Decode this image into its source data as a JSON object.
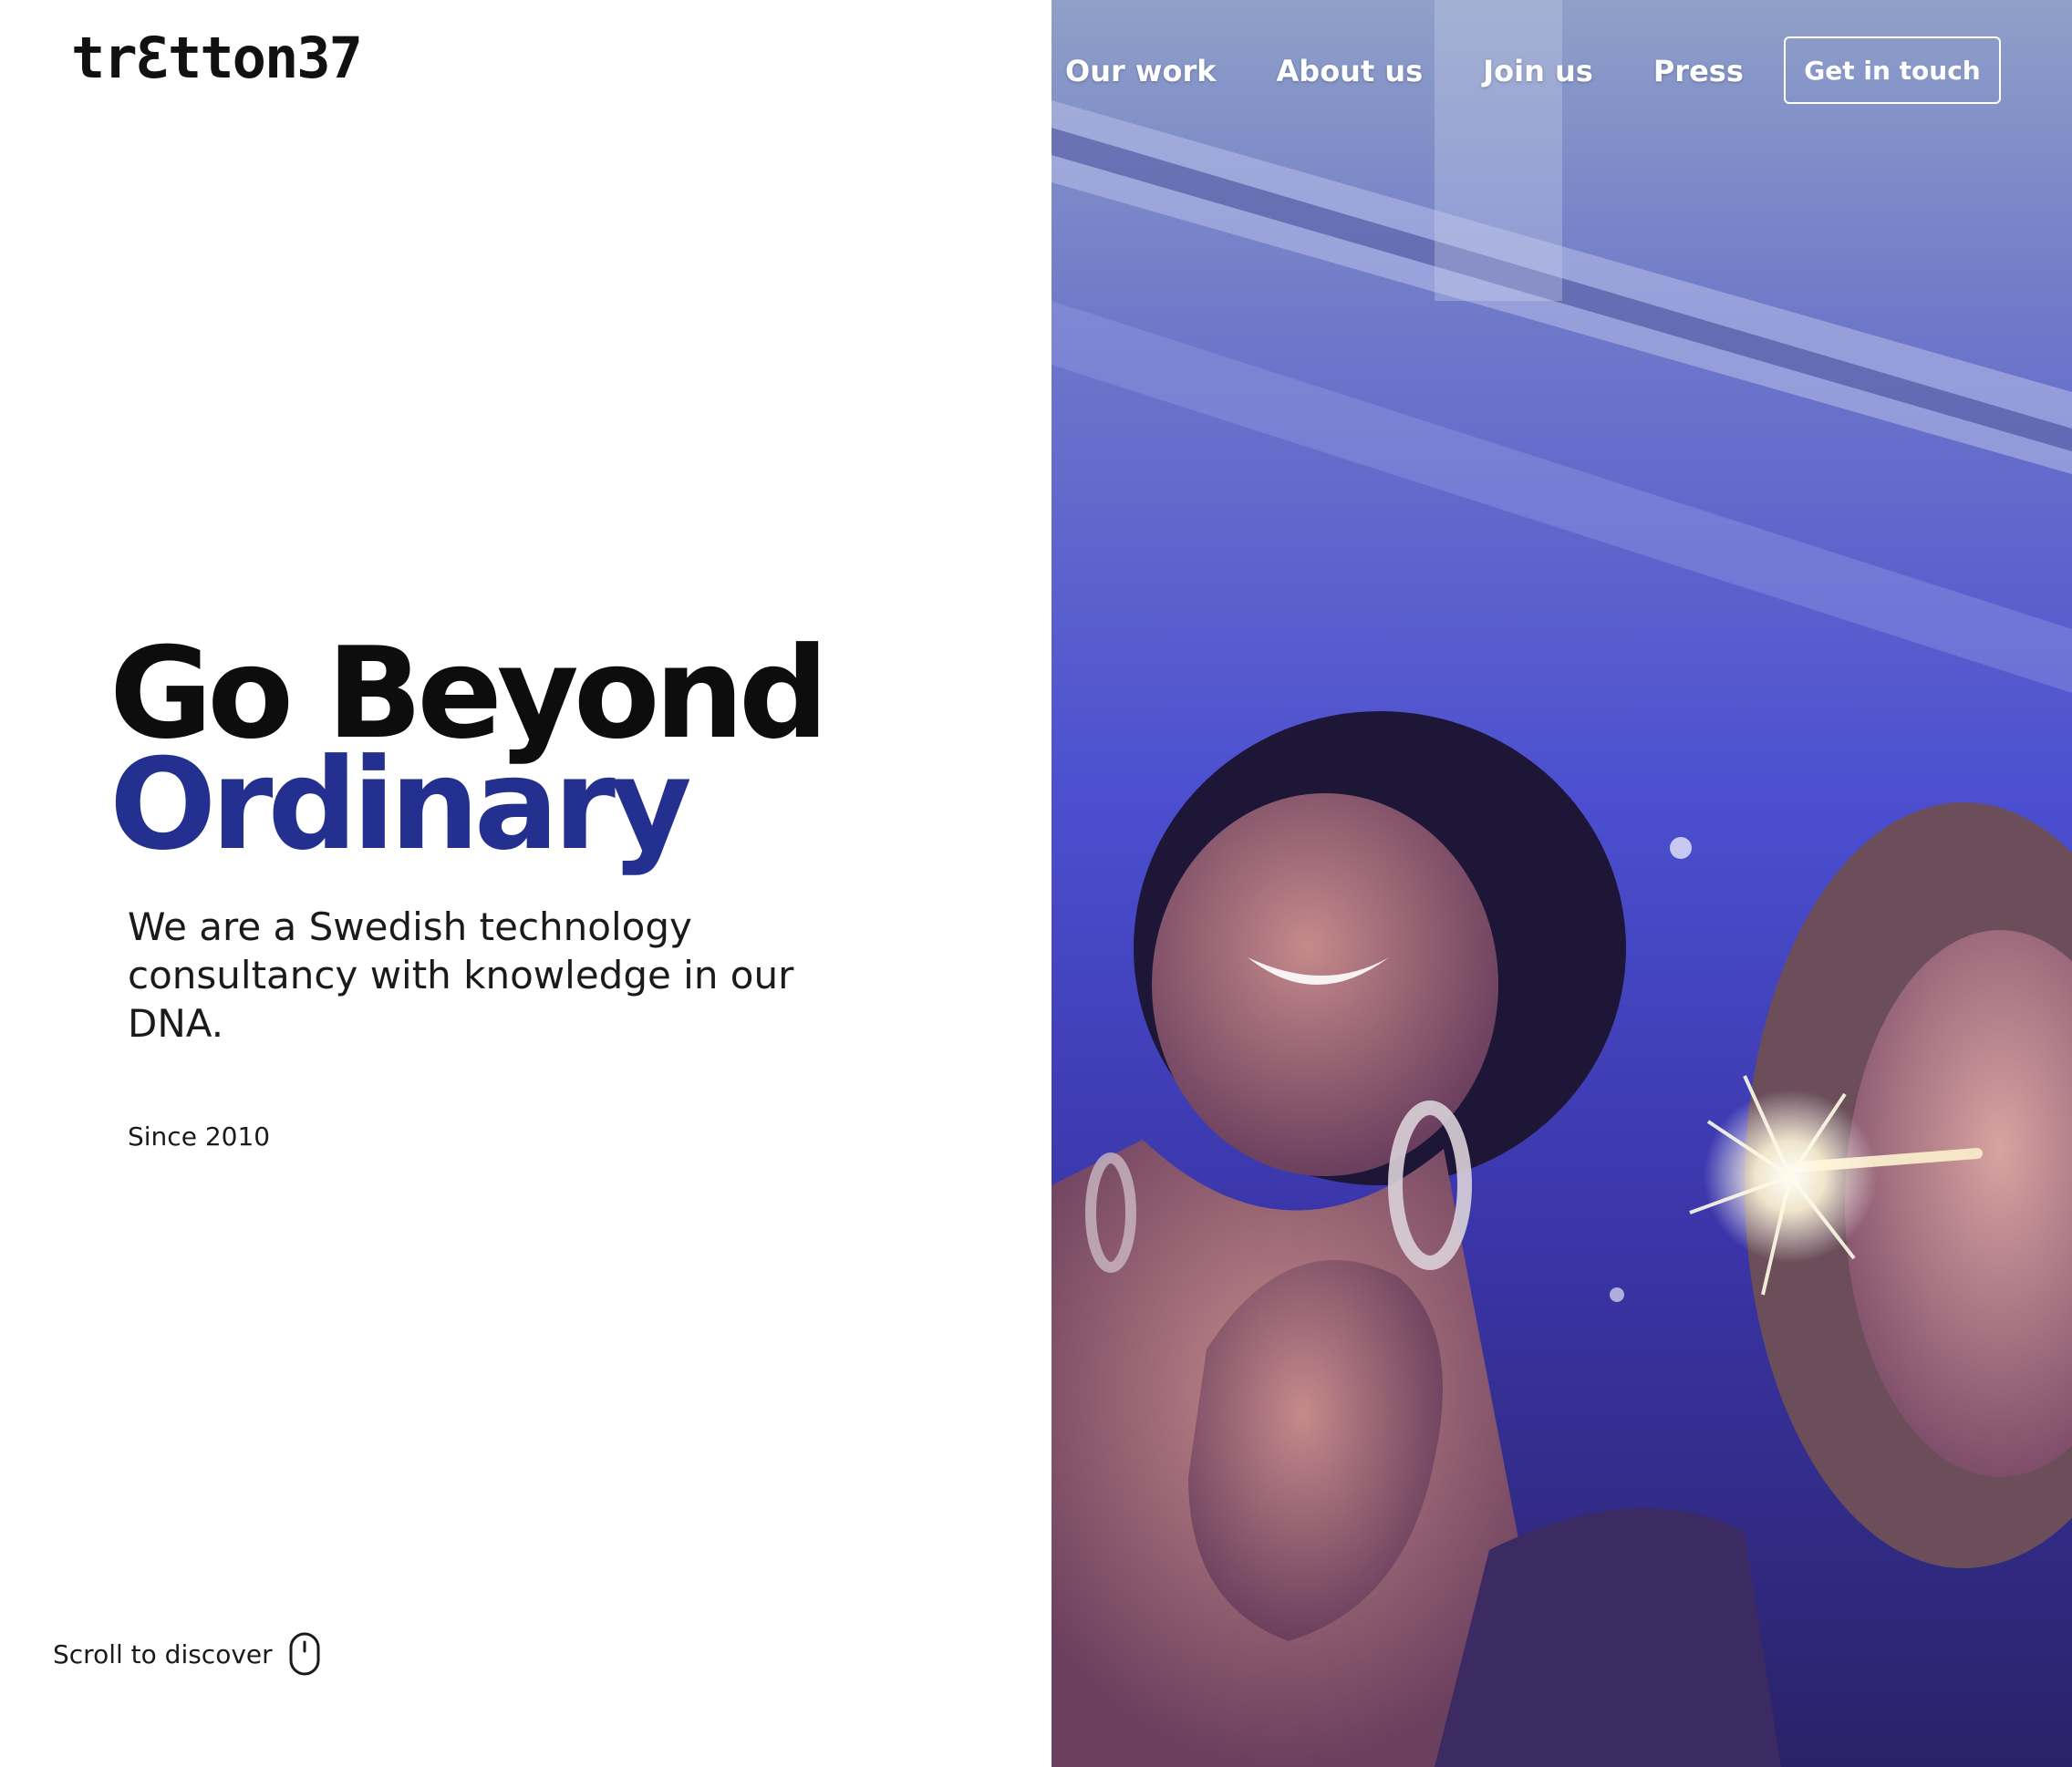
{
  "brand": {
    "logo_text": "trƐtton37"
  },
  "nav": {
    "links": [
      {
        "label": "Our work"
      },
      {
        "label": "About us"
      },
      {
        "label": "Join us"
      },
      {
        "label": "Press"
      }
    ],
    "cta_label": "Get in touch"
  },
  "hero": {
    "title_line1": "Go Beyond",
    "title_line2": "Ordinary",
    "subtitle": "We are a Swedish technology consultancy with knowledge in our DNA.",
    "since": "Since 2010"
  },
  "scroll": {
    "label": "Scroll to discover",
    "icon": "mouse-icon"
  },
  "colors": {
    "accent": "#23308f",
    "text": "#0d0d0d",
    "photo_tint": "#3b3fa6"
  }
}
